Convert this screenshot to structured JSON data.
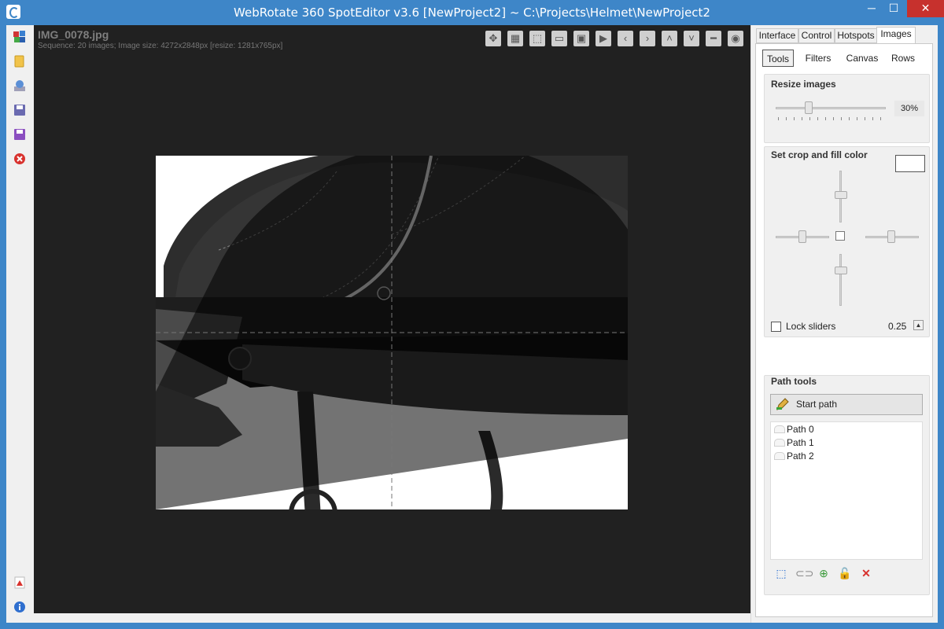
{
  "window": {
    "title": "WebRotate 360 SpotEditor v3.6 [NewProject2] ~ C:\\Projects\\Helmet\\NewProject2",
    "minimize": "─",
    "maximize": "☐",
    "close": "✕"
  },
  "left_toolbar": {
    "icons": [
      "apps-icon",
      "folder-icon",
      "publish-icon",
      "save-as-icon",
      "save-icon",
      "close-project-icon",
      "pdf-icon",
      "info-icon"
    ]
  },
  "image_view": {
    "filename": "IMG_0078.jpg",
    "info": "Sequence: 20 images; Image size: 4272x2848px [resize: 1281x765px]"
  },
  "viewer_toolbar": {
    "buttons": [
      "✥",
      "▦",
      "⬚",
      "▭",
      "▣",
      "▶",
      "‹",
      "›",
      "˄",
      "˅",
      "━",
      "◉"
    ]
  },
  "right_panel": {
    "tabs": [
      "Interface",
      "Control",
      "Hotspots",
      "Images"
    ],
    "active_tab": "Images",
    "subtabs": [
      "Tools",
      "Filters",
      "Canvas",
      "Rows"
    ],
    "active_subtab": "Tools",
    "resize": {
      "title": "Resize images",
      "percent_label": "30%",
      "value": 30
    },
    "crop": {
      "title": "Set crop and fill color",
      "fill_color": "#ffffff",
      "lock_label": "Lock sliders",
      "lock_checked": false,
      "lock_value": "0.25"
    },
    "path_tools": {
      "title": "Path tools",
      "start_label": "Start path",
      "paths": [
        "Path 0",
        "Path 1",
        "Path 2"
      ]
    }
  },
  "colors": {
    "titlebar": "#3e86c8",
    "close": "#c7312d",
    "canvas": "#212121"
  }
}
